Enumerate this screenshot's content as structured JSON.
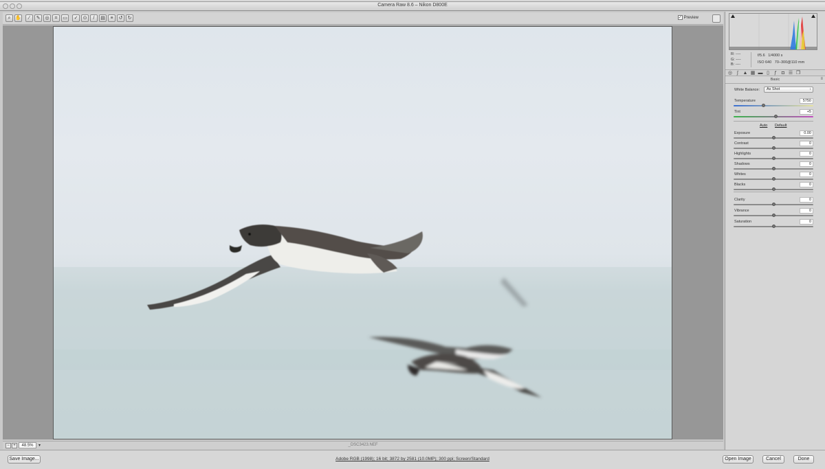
{
  "window": {
    "title": "Camera Raw 8.6  –  Nikon D800E"
  },
  "toolbar": {
    "tools": [
      "zoom-icon",
      "hand-icon",
      "white-balance-icon",
      "color-sampler-icon",
      "targeted-adjust-icon",
      "crop-icon",
      "straighten-icon",
      "spot-removal-icon",
      "red-eye-icon",
      "adjustment-brush-icon",
      "graduated-filter-icon",
      "radial-filter-icon",
      "preferences-icon",
      "rotate-left-icon",
      "rotate-right-icon"
    ],
    "preview_label": "Preview",
    "preview_checked": true
  },
  "image": {
    "filename": "_DSC3423.NEF"
  },
  "status": {
    "zoom": "48.5%"
  },
  "histogram": {
    "rgb_labels": [
      "R:",
      "G:",
      "B:"
    ],
    "rgb_values": [
      "----",
      "----",
      "----"
    ],
    "aperture": "f/5.6",
    "shutter": "1/4000 s",
    "iso": "ISO 640",
    "lens": "70–300@110 mm"
  },
  "panel": {
    "title": "Basic",
    "white_balance_label": "White Balance:",
    "white_balance_value": "As Shot",
    "auto_label": "Auto",
    "default_label": "Default",
    "sliders": [
      {
        "label": "Temperature",
        "value": "5750",
        "position": 0.37
      },
      {
        "label": "Tint",
        "value": "+5",
        "position": 0.53
      },
      {
        "label": "Exposure",
        "value": "0.00",
        "position": 0.5
      },
      {
        "label": "Contrast",
        "value": "0",
        "position": 0.5
      },
      {
        "label": "Highlights",
        "value": "0",
        "position": 0.5
      },
      {
        "label": "Shadows",
        "value": "0",
        "position": 0.5
      },
      {
        "label": "Whites",
        "value": "0",
        "position": 0.5
      },
      {
        "label": "Blacks",
        "value": "0",
        "position": 0.5
      },
      {
        "label": "Clarity",
        "value": "0",
        "position": 0.5
      },
      {
        "label": "Vibrance",
        "value": "0",
        "position": 0.5
      },
      {
        "label": "Saturation",
        "value": "0",
        "position": 0.5
      }
    ]
  },
  "bottom": {
    "save_label": "Save Image...",
    "workflow": "Adobe RGB (1998); 16 bit; 3872 by 2581 (10.0MP); 300 ppi; Screen/Standard",
    "open_label": "Open Image",
    "cancel_label": "Cancel",
    "done_label": "Done"
  }
}
